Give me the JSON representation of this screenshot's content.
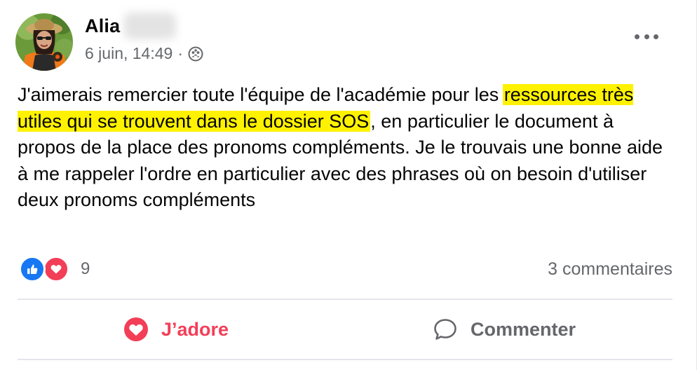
{
  "post": {
    "author": "Alia",
    "timestamp": "6 juin, 14:49",
    "separator": "·",
    "audience_icon": "group-icon",
    "text_before": "J'aimerais remercier toute l'équipe de l'académie pour les ",
    "text_highlight": "ressources très utiles qui se trouvent dans le dossier SOS",
    "text_after": ", en particulier le document à propos de la place des pronoms compléments. Je le trouvais une bonne aide à me rappeler l'ordre en particulier avec des phrases où on besoin d'utiliser deux pronoms compléments",
    "highlight_color": "#fff200"
  },
  "reactions": {
    "icons": [
      "like-icon",
      "love-icon"
    ],
    "count": "9",
    "comments": "3 commentaires"
  },
  "actions": {
    "love_label": "J’adore",
    "comment_label": "Commenter"
  },
  "colors": {
    "love": "#f33e58",
    "like": "#1877f2",
    "secondary_text": "#65676b"
  }
}
